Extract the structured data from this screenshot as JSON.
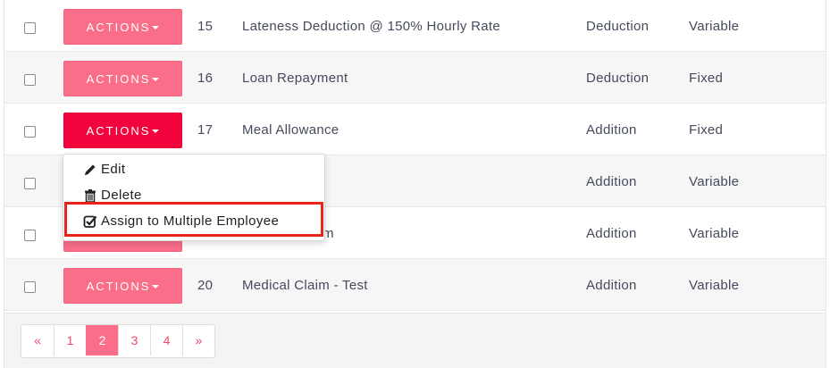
{
  "rows": [
    {
      "id": "15",
      "name": "Lateness Deduction @ 150% Hourly Rate",
      "type": "Deduction",
      "mode": "Variable",
      "action_label": "ACTIONS"
    },
    {
      "id": "16",
      "name": "Loan Repayment",
      "type": "Deduction",
      "mode": "Fixed",
      "action_label": "ACTIONS"
    },
    {
      "id": "17",
      "name": "Meal Allowance",
      "type": "Addition",
      "mode": "Fixed",
      "action_label": "ACTIONS"
    },
    {
      "id": "",
      "name": "",
      "type": "Addition",
      "mode": "Variable",
      "action_label": ""
    },
    {
      "id": "",
      "name": "m",
      "type": "Addition",
      "mode": "Variable",
      "action_label": ""
    },
    {
      "id": "20",
      "name": "Medical Claim - Test",
      "type": "Addition",
      "mode": "Variable",
      "action_label": "ACTIONS"
    }
  ],
  "dropdown": {
    "edit": "Edit",
    "delete": "Delete",
    "assign": "Assign to Multiple Employee"
  },
  "pagination": {
    "prev": "«",
    "pages": [
      "1",
      "2",
      "3",
      "4"
    ],
    "active": "2",
    "next": "»"
  },
  "colors": {
    "button": "#fa6e8a",
    "button_open": "#f2033e",
    "highlight": "#e8231a",
    "page_link": "#f2466b"
  },
  "icons": {
    "edit": "pencil-icon",
    "delete": "trash-icon",
    "assign": "check-square-icon",
    "caret": "caret-down-icon"
  }
}
